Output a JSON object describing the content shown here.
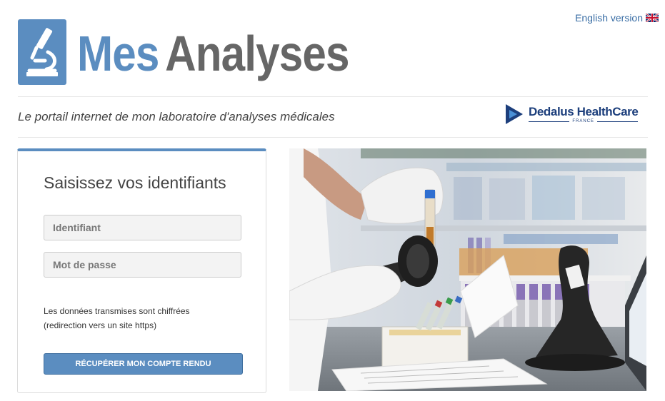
{
  "header": {
    "language_link": "English version",
    "brand_part1": "Mes",
    "brand_part2": "Analyses",
    "tagline": "Le portail internet de mon laboratoire d'analyses médicales",
    "partner_name": "Dedalus HealthCare",
    "partner_sub": "FRANCE"
  },
  "login": {
    "title": "Saisissez vos identifiants",
    "username_placeholder": "Identifiant",
    "password_placeholder": "Mot de passe",
    "note_line1": "Les données transmises sont chiffrées",
    "note_line2": "(redirection vers un site https)",
    "submit_label": "RÉCUPÉRER MON COMPTE RENDU"
  },
  "colors": {
    "brand_blue": "#5b8dc0",
    "brand_gray": "#666666",
    "partner_navy": "#1d3f7c",
    "link_blue": "#3a6ea5"
  },
  "icons": {
    "logo": "microscope-icon",
    "language_flag": "uk-flag-icon",
    "partner_logo": "dedalus-logo-icon"
  }
}
